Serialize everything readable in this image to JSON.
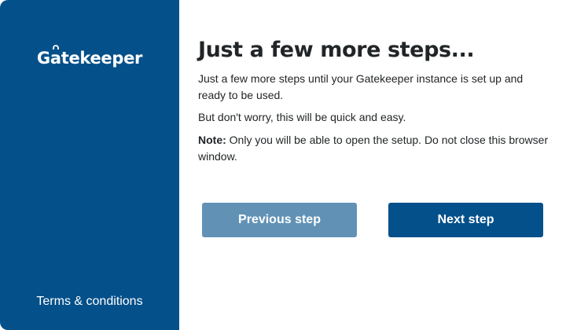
{
  "brand": {
    "logo_prefix": "G",
    "logo_a": "a",
    "logo_suffix": "tekeeper",
    "logo_text": "Gatekeeper"
  },
  "sidebar": {
    "terms_label": "Terms & conditions"
  },
  "main": {
    "title": "Just a few more steps...",
    "paragraph_1": "Just a few more steps until your Gatekeeper instance is set up and ready to be used.",
    "paragraph_2": "But don't worry, this will be quick and easy.",
    "note_label": "Note:",
    "note_text": " Only you will be able to open the setup. Do not close this browser window."
  },
  "buttons": {
    "previous_label": "Previous step",
    "next_label": "Next step"
  },
  "colors": {
    "sidebar_bg": "#04508a",
    "primary_button": "#03508a",
    "disabled_button": "#6192b6"
  },
  "icons": {
    "logo_lock": "lock-icon"
  }
}
